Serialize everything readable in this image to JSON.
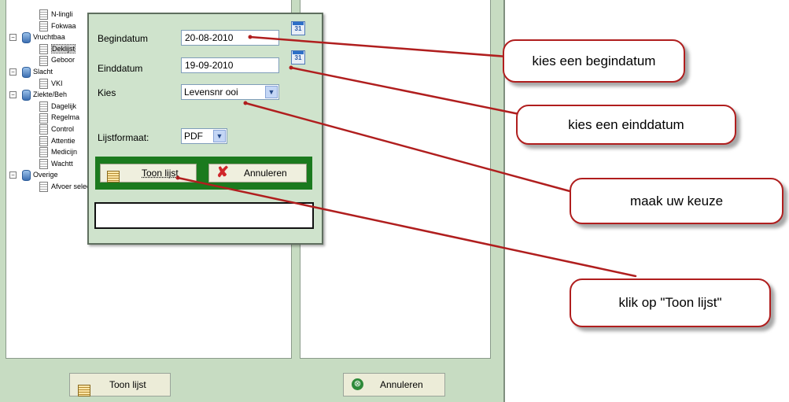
{
  "tree": {
    "items": [
      {
        "label": "N-lingli",
        "indent": 2
      },
      {
        "label": "Fokwaa",
        "indent": 2
      },
      {
        "label": "Vruchtbaa",
        "indent": 1
      },
      {
        "label": "Deklijst",
        "indent": 2
      },
      {
        "label": "Geboor",
        "indent": 2
      },
      {
        "label": "Slacht",
        "indent": 1
      },
      {
        "label": "VKI",
        "indent": 2
      },
      {
        "label": "Ziekte/Beh",
        "indent": 1
      },
      {
        "label": "Dagelijk",
        "indent": 2
      },
      {
        "label": "Regelma",
        "indent": 2
      },
      {
        "label": "Control",
        "indent": 2
      },
      {
        "label": "Attentie",
        "indent": 2
      },
      {
        "label": "Medicijn",
        "indent": 2
      },
      {
        "label": "Wachtt",
        "indent": 2
      },
      {
        "label": "Overige",
        "indent": 1
      },
      {
        "label": "Afvoer selectie",
        "indent": 2
      }
    ]
  },
  "app_buttons": {
    "show_list": "Toon lijst",
    "cancel": "Annuleren"
  },
  "dialog": {
    "begin_label": "Begindatum",
    "begin_value": "20-08-2010",
    "end_label": "Einddatum",
    "end_value": "19-09-2010",
    "calendar_icon_text": "31",
    "choose_label": "Kies",
    "choose_value": "Levensnr ooi",
    "format_label": "Lijstformaat:",
    "format_value": "PDF",
    "show_button": "Toon lijst",
    "cancel_button": "Annuleren"
  },
  "callouts": {
    "begin": "kies een begindatum",
    "end": "kies een einddatum",
    "choice": "maak uw keuze",
    "show": "klik op \"Toon lijst\""
  },
  "colors": {
    "app_bg": "#c7dcc2",
    "dialog_bg": "#cfe3cc",
    "button_bar": "#1b7a1e",
    "callout_border": "#b01e1e"
  }
}
